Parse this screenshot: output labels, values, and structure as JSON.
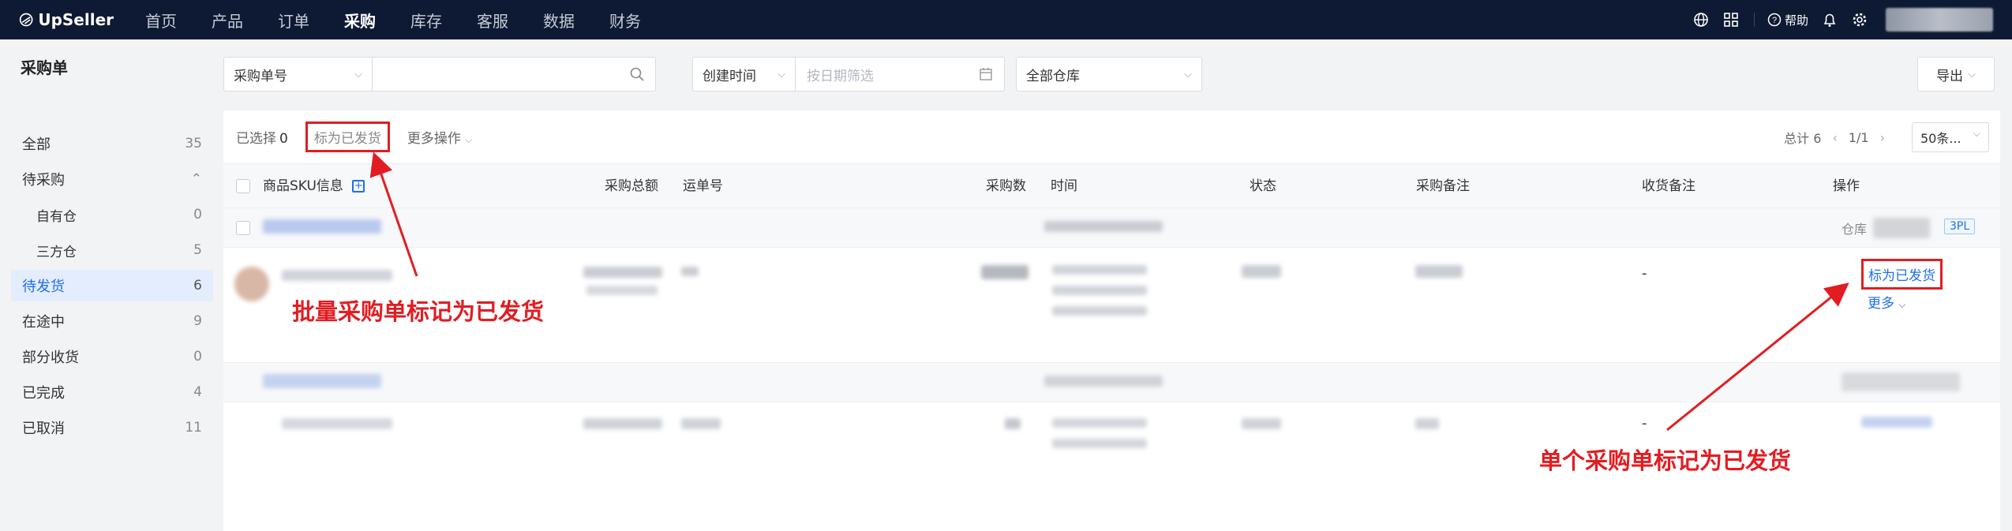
{
  "app": {
    "brand": "UpSeller"
  },
  "topnav": {
    "items": [
      "首页",
      "产品",
      "订单",
      "采购",
      "库存",
      "客服",
      "数据",
      "财务"
    ],
    "active_index": 3,
    "help_label": "帮助"
  },
  "sidebar": {
    "title": "采购单",
    "items": [
      {
        "label": "全部",
        "count": "35"
      },
      {
        "label": "待采购",
        "count": ""
      },
      {
        "label": "自有仓",
        "count": "0"
      },
      {
        "label": "三方仓",
        "count": "5"
      },
      {
        "label": "待发货",
        "count": "6"
      },
      {
        "label": "在途中",
        "count": "9"
      },
      {
        "label": "部分收货",
        "count": "0"
      },
      {
        "label": "已完成",
        "count": "4"
      },
      {
        "label": "已取消",
        "count": "11"
      }
    ],
    "active": "待发货"
  },
  "filters": {
    "search_type": "采购单号",
    "search_value": "",
    "date_type": "创建时间",
    "date_placeholder": "按日期筛选",
    "warehouse": "全部仓库",
    "export_label": "导出"
  },
  "toolbar": {
    "selected_label": "已选择",
    "selected_count": "0",
    "mark_shipped_label": "标为已发货",
    "more_ops_label": "更多操作"
  },
  "pager": {
    "total_label": "总计 6",
    "page": "1/1",
    "page_size": "50条..."
  },
  "table": {
    "columns": [
      "商品SKU信息",
      "采购总额",
      "运单号",
      "采购数",
      "时间",
      "状态",
      "采购备注",
      "收货备注",
      "操作"
    ]
  },
  "rows": [
    {
      "warehouse_label": "仓库",
      "tag": "3PL",
      "receipt_note": "-",
      "action_mark": "标为已发货",
      "action_more": "更多"
    },
    {
      "receipt_note": "-"
    }
  ],
  "annotations": {
    "batch": "批量采购单标记为已发货",
    "single": "单个采购单标记为已发货"
  },
  "colors": {
    "nav_bg": "#0e1a33",
    "accent": "#1f6feb",
    "highlight_red": "#e21d22"
  }
}
